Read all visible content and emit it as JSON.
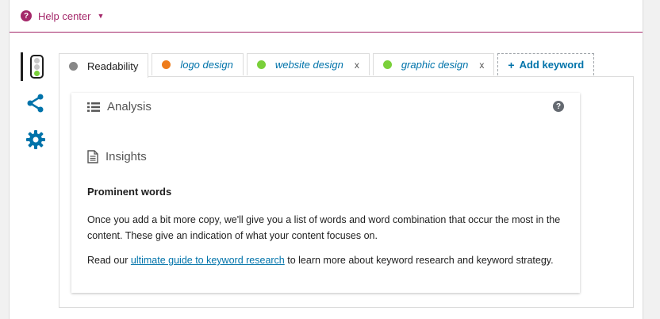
{
  "help": {
    "label": "Help center",
    "icon": "question-circle-icon",
    "caret": "▼",
    "color": "#a4286a"
  },
  "sidebar": {
    "items": [
      {
        "name": "readability-traffic-light",
        "icon": "traffic-light-icon"
      },
      {
        "name": "social-share",
        "icon": "share-icon"
      },
      {
        "name": "advanced-settings",
        "icon": "gear-icon"
      }
    ],
    "icon_color": "#0073aa"
  },
  "tabs": [
    {
      "label": "Readability",
      "score_color": "#888888",
      "italic": false,
      "removable": false
    },
    {
      "label": "logo design",
      "score_color": "#ee7c1b",
      "italic": true,
      "removable": false
    },
    {
      "label": "website design",
      "score_color": "#7ad03a",
      "italic": true,
      "removable": true
    },
    {
      "label": "graphic design",
      "score_color": "#7ad03a",
      "italic": true,
      "removable": true
    }
  ],
  "remove_label": "x",
  "add_keyword": {
    "plus": "+",
    "label": "Add keyword"
  },
  "analysis": {
    "label": "Analysis",
    "icon": "list-icon",
    "help_icon": "question-icon"
  },
  "insights": {
    "label": "Insights",
    "icon": "document-icon",
    "heading": "Prominent words",
    "para1": "Once you add a bit more copy, we'll give you a list of words and word combination that occur the most in the content. These give an indication of what your content focuses on.",
    "para2_before": "Read our ",
    "para2_link": "ultimate guide to keyword research",
    "para2_after": " to learn more about keyword research and keyword strategy."
  }
}
